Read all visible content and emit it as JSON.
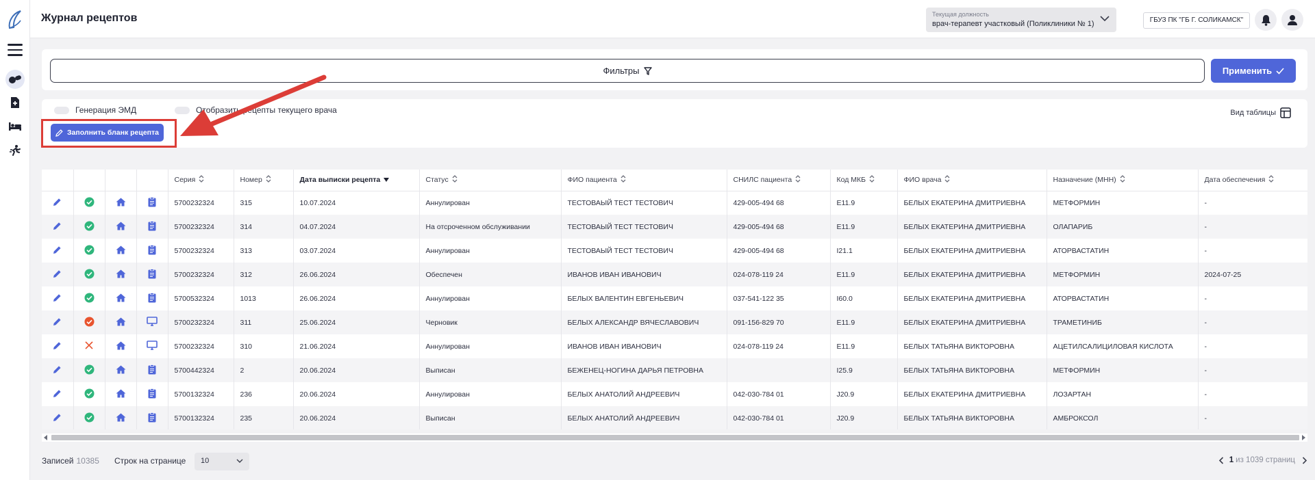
{
  "header": {
    "title": "Журнал рецептов",
    "position_label": "Текущая должность",
    "position_value": "врач-терапевт участковый (Поликлиники № 1)",
    "organization": "ГБУЗ ПК \"ГБ Г. СОЛИКАМСК\""
  },
  "filters": {
    "label": "Фильтры",
    "apply_label": "Применить"
  },
  "options": {
    "emd_toggle_label": "Генерация ЭМД",
    "current_doctor_toggle_label": "Отобразить рецепты текущего врача",
    "fill_button_label": "Заполнить бланк рецепта",
    "view_table_label": "Вид таблицы"
  },
  "table": {
    "columns": [
      "Серия",
      "Номер",
      "Дата выписки рецепта",
      "Статус",
      "ФИО пациента",
      "СНИЛС пациента",
      "Код МКБ",
      "ФИО врача",
      "Назначение (МНН)",
      "Дата обеспечения"
    ],
    "sorted_column": "Дата выписки рецепта",
    "rows": [
      {
        "sign": "ok",
        "type": "clipboard",
        "series": "5700232324",
        "number": "315",
        "date": "10.07.2024",
        "status": "Аннулирован",
        "patient": "ТЕСТОВАЫЙ ТЕСТ ТЕСТОВИЧ",
        "snils": "429-005-494 68",
        "mkb": "E11.9",
        "doctor": "БЕЛЫХ ЕКАТЕРИНА ДМИТРИЕВНА",
        "drug": "МЕТФОРМИН",
        "supply_date": "-"
      },
      {
        "sign": "ok",
        "type": "clipboard",
        "series": "5700232324",
        "number": "314",
        "date": "04.07.2024",
        "status": "На отсроченном обслуживании",
        "patient": "ТЕСТОВАЫЙ ТЕСТ ТЕСТОВИЧ",
        "snils": "429-005-494 68",
        "mkb": "E11.9",
        "doctor": "БЕЛЫХ ЕКАТЕРИНА ДМИТРИЕВНА",
        "drug": "ОЛАПАРИБ",
        "supply_date": "-"
      },
      {
        "sign": "ok",
        "type": "clipboard",
        "series": "5700232324",
        "number": "313",
        "date": "03.07.2024",
        "status": "Аннулирован",
        "patient": "ТЕСТОВАЫЙ ТЕСТ ТЕСТОВИЧ",
        "snils": "429-005-494 68",
        "mkb": "I21.1",
        "doctor": "БЕЛЫХ ЕКАТЕРИНА ДМИТРИЕВНА",
        "drug": "АТОРВАСТАТИН",
        "supply_date": "-"
      },
      {
        "sign": "ok",
        "type": "clipboard",
        "series": "5700232324",
        "number": "312",
        "date": "26.06.2024",
        "status": "Обеспечен",
        "patient": "ИВАНОВ ИВАН ИВАНОВИЧ",
        "snils": "024-078-119 24",
        "mkb": "E11.9",
        "doctor": "БЕЛЫХ ЕКАТЕРИНА ДМИТРИЕВНА",
        "drug": "МЕТФОРМИН",
        "supply_date": "2024-07-25"
      },
      {
        "sign": "ok",
        "type": "clipboard",
        "series": "5700532324",
        "number": "1013",
        "date": "26.06.2024",
        "status": "Аннулирован",
        "patient": "БЕЛЫХ ВАЛЕНТИН ЕВГЕНЬЕВИЧ",
        "snils": "037-541-122 35",
        "mkb": "I60.0",
        "doctor": "БЕЛЫХ ЕКАТЕРИНА ДМИТРИЕВНА",
        "drug": "АТОРВАСТАТИН",
        "supply_date": "-"
      },
      {
        "sign": "error",
        "type": "monitor",
        "series": "5700232324",
        "number": "311",
        "date": "25.06.2024",
        "status": "Черновик",
        "patient": "БЕЛЫХ АЛЕКСАНДР ВЯЧЕСЛАВОВИЧ",
        "snils": "091-156-829 70",
        "mkb": "E11.9",
        "doctor": "БЕЛЫХ ЕКАТЕРИНА ДМИТРИЕВНА",
        "drug": "ТРАМЕТИНИБ",
        "supply_date": "-"
      },
      {
        "sign": "none",
        "type": "monitor",
        "series": "5700232324",
        "number": "310",
        "date": "21.06.2024",
        "status": "Аннулирован",
        "patient": "ИВАНОВ ИВАН ИВАНОВИЧ",
        "snils": "024-078-119 24",
        "mkb": "E11.9",
        "doctor": "БЕЛЫХ ТАТЬЯНА ВИКТОРОВНА",
        "drug": "АЦЕТИЛСАЛИЦИЛОВАЯ КИСЛОТА",
        "supply_date": "-"
      },
      {
        "sign": "ok",
        "type": "clipboard",
        "series": "5700442324",
        "number": "2",
        "date": "20.06.2024",
        "status": "Выписан",
        "patient": "БЕЖЕНЕЦ-НОГИНА ДАРЬЯ ПЕТРОВНА",
        "snils": "",
        "mkb": "I25.9",
        "doctor": "БЕЛЫХ ТАТЬЯНА ВИКТОРОВНА",
        "drug": "МЕТФОРМИН",
        "supply_date": "-"
      },
      {
        "sign": "ok",
        "type": "clipboard",
        "series": "5700132324",
        "number": "236",
        "date": "20.06.2024",
        "status": "Аннулирован",
        "patient": "БЕЛЫХ АНАТОЛИЙ АНДРЕЕВИЧ",
        "snils": "042-030-784 01",
        "mkb": "J20.9",
        "doctor": "БЕЛЫХ ЕКАТЕРИНА ДМИТРИЕВНА",
        "drug": "ЛОЗАРТАН",
        "supply_date": "-"
      },
      {
        "sign": "ok",
        "type": "clipboard",
        "series": "5700132324",
        "number": "235",
        "date": "20.06.2024",
        "status": "Выписан",
        "patient": "БЕЛЫХ АНАТОЛИЙ АНДРЕЕВИЧ",
        "snils": "042-030-784 01",
        "mkb": "J20.9",
        "doctor": "БЕЛЫХ ТАТЬЯНА ВИКТОРОВНА",
        "drug": "АМБРОКСОЛ",
        "supply_date": "-"
      }
    ]
  },
  "footer": {
    "records_label": "Записей",
    "records_count": "10385",
    "rows_per_page_label": "Строк на странице",
    "rows_per_page_value": "10",
    "current_page": "1",
    "total_pages_text": "из 1039 страниц"
  },
  "colors": {
    "accent": "#4f66d9",
    "success": "#2fb67c",
    "error": "#e8542f",
    "highlight": "#dc3d37"
  },
  "icons": [
    "logo-icon",
    "menu-icon",
    "pills-icon",
    "document-icon",
    "bed-icon",
    "running-person-icon",
    "chevron-down-icon",
    "bell-icon",
    "user-icon",
    "filter-icon",
    "check-icon",
    "pencil-icon",
    "table-view-icon",
    "sort-icon",
    "check-circle-icon",
    "error-circle-icon",
    "cross-icon",
    "home-icon",
    "clipboard-icon",
    "monitor-icon",
    "chevron-left-icon",
    "chevron-right-icon"
  ]
}
